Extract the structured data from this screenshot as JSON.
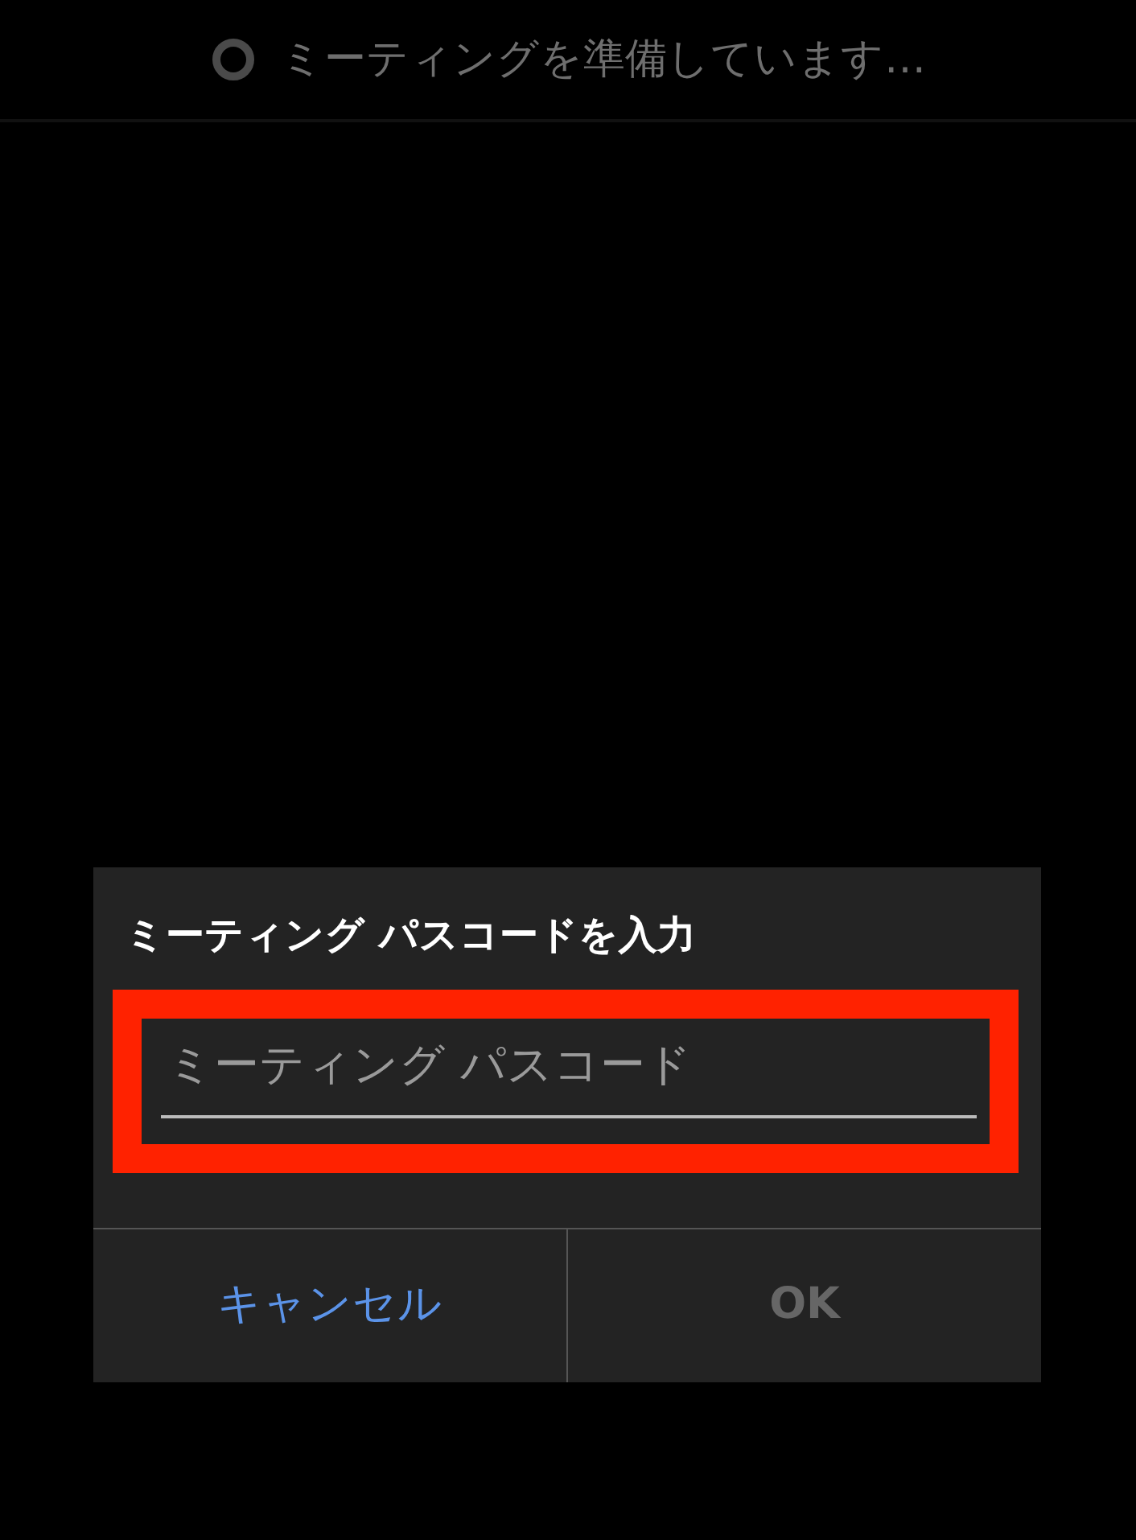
{
  "status_bar": {
    "text": "ミーティングを準備しています…",
    "loading": true
  },
  "dialog": {
    "title": "ミーティング パスコードを入力",
    "field": {
      "placeholder": "ミーティング パスコード",
      "highlighted": true
    },
    "buttons": [
      {
        "label": "キャンセル",
        "disabled": false
      },
      {
        "label": "OK",
        "disabled": true
      }
    ]
  }
}
